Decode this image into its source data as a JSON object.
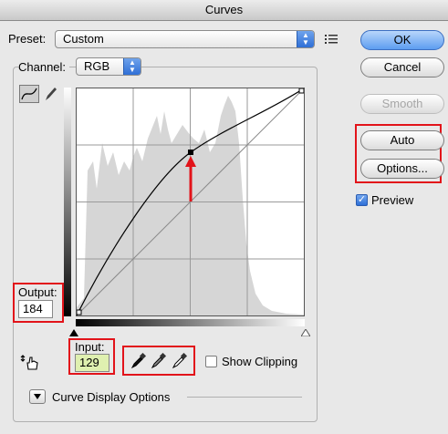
{
  "window": {
    "title": "Curves"
  },
  "preset": {
    "label": "Preset:",
    "value": "Custom"
  },
  "channel": {
    "label": "Channel:",
    "value": "RGB"
  },
  "buttons": {
    "ok": "OK",
    "cancel": "Cancel",
    "smooth": "Smooth",
    "auto": "Auto",
    "options": "Options..."
  },
  "preview": {
    "label": "Preview",
    "checked": true
  },
  "output": {
    "label": "Output:",
    "value": "184"
  },
  "input": {
    "label": "Input:",
    "value": "129"
  },
  "show_clipping": {
    "label": "Show Clipping",
    "checked": false
  },
  "curve_display": {
    "label": "Curve Display Options"
  },
  "curve": {
    "input": 129,
    "output": 184,
    "range": [
      0,
      255
    ]
  },
  "colors": {
    "highlight": "#e2131a",
    "input_field_bg": "#dff0b0",
    "accent": "#2f6fd6"
  }
}
